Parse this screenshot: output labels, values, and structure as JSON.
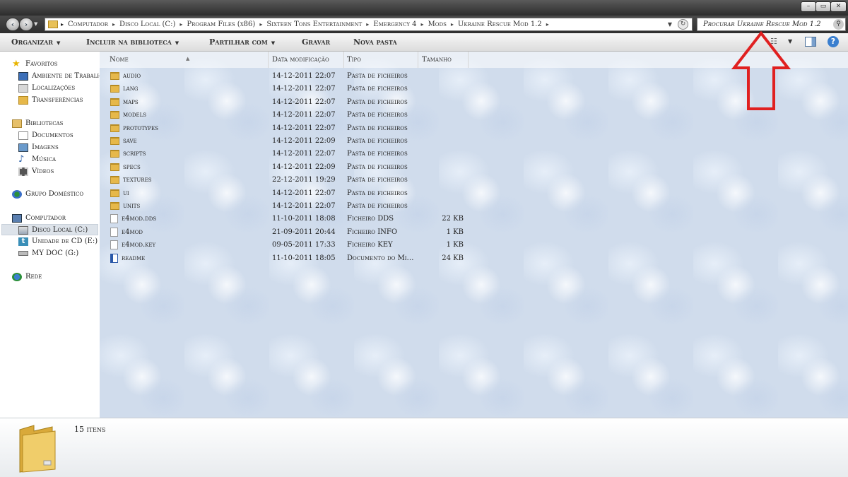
{
  "window": {
    "minimize_label": "–",
    "maximize_label": "▭",
    "close_label": "✕"
  },
  "address": {
    "crumbs": [
      "Computador",
      "Disco Local (C:)",
      "Program Files (x86)",
      "Sixteen Tons Entertainment",
      "Emergency 4",
      "Mods",
      "Ukraine Rescue Mod 1.2"
    ],
    "search_placeholder": "Procurar Ukraine Rescue Mod 1.2"
  },
  "toolbar": {
    "organize": "Organizar",
    "include_library": "Incluir na biblioteca",
    "share_with": "Partilhar com",
    "burn": "Gravar",
    "new_folder": "Nova pasta"
  },
  "nav": {
    "favorites_header": "Favoritos",
    "favorites": [
      "Ambiente de Trabalho",
      "Localizações",
      "Transferências"
    ],
    "libraries_header": "Bibliotecas",
    "libraries": [
      "Documentos",
      "Imagens",
      "Música",
      "Vídeos"
    ],
    "homegroup": "Grupo Doméstico",
    "computer_header": "Computador",
    "drives": [
      "Disco Local (C:)",
      "Unidade de CD (E:)",
      "MY DOC (G:)"
    ],
    "network": "Rede"
  },
  "columns": {
    "name": "Nome",
    "date": "Data modificação",
    "type": "Tipo",
    "size": "Tamanho"
  },
  "files": [
    {
      "name": "audio",
      "date": "14-12-2011 22:07",
      "type": "Pasta de ficheiros",
      "size": "",
      "icon": "folder"
    },
    {
      "name": "lang",
      "date": "14-12-2011 22:07",
      "type": "Pasta de ficheiros",
      "size": "",
      "icon": "folder"
    },
    {
      "name": "maps",
      "date": "14-12-2011 22:07",
      "type": "Pasta de ficheiros",
      "size": "",
      "icon": "folder"
    },
    {
      "name": "models",
      "date": "14-12-2011 22:07",
      "type": "Pasta de ficheiros",
      "size": "",
      "icon": "folder"
    },
    {
      "name": "prototypes",
      "date": "14-12-2011 22:07",
      "type": "Pasta de ficheiros",
      "size": "",
      "icon": "folder"
    },
    {
      "name": "save",
      "date": "14-12-2011 22:09",
      "type": "Pasta de ficheiros",
      "size": "",
      "icon": "folder"
    },
    {
      "name": "scripts",
      "date": "14-12-2011 22:07",
      "type": "Pasta de ficheiros",
      "size": "",
      "icon": "folder"
    },
    {
      "name": "specs",
      "date": "14-12-2011 22:09",
      "type": "Pasta de ficheiros",
      "size": "",
      "icon": "folder"
    },
    {
      "name": "textures",
      "date": "22-12-2011 19:29",
      "type": "Pasta de ficheiros",
      "size": "",
      "icon": "folder"
    },
    {
      "name": "ui",
      "date": "14-12-2011 22:07",
      "type": "Pasta de ficheiros",
      "size": "",
      "icon": "folder"
    },
    {
      "name": "units",
      "date": "14-12-2011 22:07",
      "type": "Pasta de ficheiros",
      "size": "",
      "icon": "folder"
    },
    {
      "name": "e4mod.dds",
      "date": "11-10-2011 18:08",
      "type": "Ficheiro DDS",
      "size": "22 KB",
      "icon": "file"
    },
    {
      "name": "e4mod",
      "date": "21-09-2011 20:44",
      "type": "Ficheiro INFO",
      "size": "1 KB",
      "icon": "file"
    },
    {
      "name": "e4mod.key",
      "date": "09-05-2011 17:33",
      "type": "Ficheiro KEY",
      "size": "1 KB",
      "icon": "file"
    },
    {
      "name": "readme",
      "date": "11-10-2011 18:05",
      "type": "Documento do Microsoft Word",
      "size": "24 KB",
      "icon": "doc"
    }
  ],
  "details": {
    "item_count": "15 itens"
  },
  "colors": {
    "annotation_arrow": "#e02020",
    "folder": "#e6b84a"
  }
}
